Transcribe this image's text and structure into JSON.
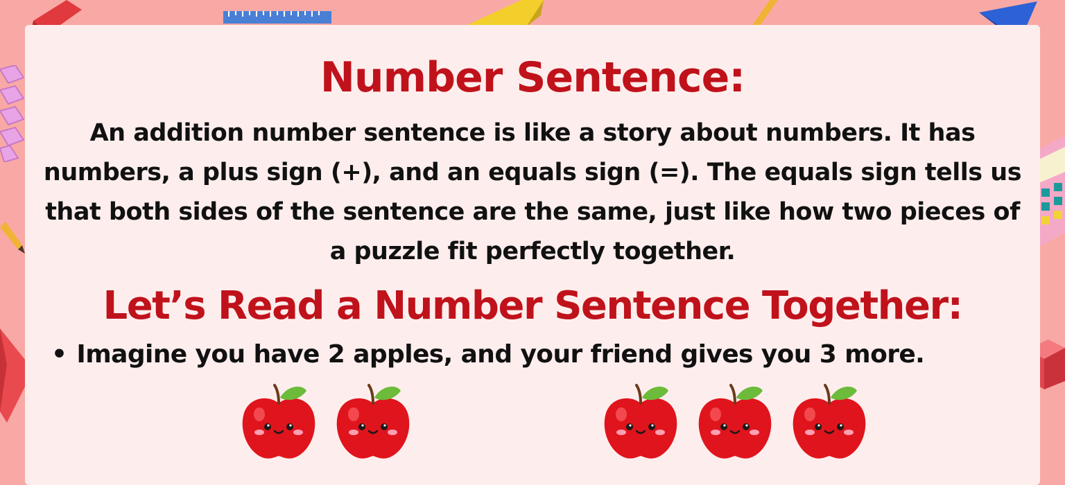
{
  "title": "Number Sentence:",
  "paragraph": "An addition number sentence is like a story about numbers. It has numbers, a plus sign (+), and an equals sign (=). The equals sign tells us that both sides of the sentence are the same, just like how two pieces of a puzzle fit perfectly together.",
  "subtitle": "Let’s Read a Number Sentence Together:",
  "bullet": {
    "marker": "•",
    "text": "Imagine you have 2 apples, and your friend gives you 3 more."
  },
  "apples": {
    "left_group_count": 2,
    "right_group_count": 3,
    "icon": "apple-icon"
  },
  "colors": {
    "background": "#f9a9a5",
    "card": "#fdeeed",
    "heading": "#c0121b",
    "text": "#111111",
    "apple": "#e0141c",
    "leaf": "#6dbb3a"
  }
}
